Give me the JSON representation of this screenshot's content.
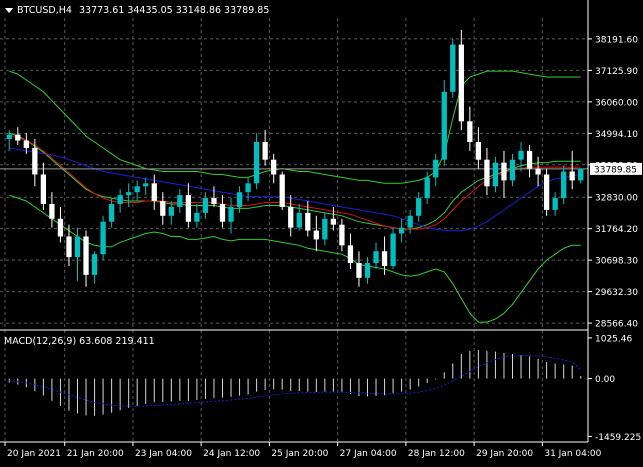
{
  "header": {
    "menu_icon": "triangle-down-icon",
    "symbol": "BTCUSD,H4",
    "ohlc": "33773.61 34435.05 33148.86 33789.85"
  },
  "macd_label": "MACD(12,26,9) 63.608 219.411",
  "colors": {
    "background": "#000000",
    "grid": "#5a5a5a",
    "up_candle": "#00bfbf",
    "down_candle": "#ffffff",
    "bands": "#33cc33",
    "red_ma": "#e01010",
    "blue_ma": "#1c1cd8",
    "text": "#ffffff",
    "price_tag": "#ffffff"
  },
  "chart_data": [
    {
      "type": "candlestick",
      "y_ticks": [
        "38191.60",
        "37125.90",
        "36060.00",
        "34994.10",
        "33928.20",
        "32830.00",
        "31764.20",
        "30698.30",
        "29632.30",
        "28566.40"
      ],
      "ylim": [
        28400,
        38900
      ],
      "last_price": "33789.85",
      "x_ticks": [
        "20 Jan 2021",
        "21 Jan 20:00",
        "23 Jan 04:00",
        "24 Jan 12:00",
        "25 Jan 20:00",
        "27 Jan 04:00",
        "28 Jan 12:00",
        "29 Jan 20:00",
        "31 Jan 04:00"
      ],
      "grid": true,
      "ohlc": [
        [
          34800,
          35100,
          34400,
          34950
        ],
        [
          34950,
          35200,
          34600,
          34750
        ],
        [
          34750,
          35000,
          34300,
          34500
        ],
        [
          34500,
          34800,
          33200,
          33600
        ],
        [
          33600,
          34000,
          32400,
          32600
        ],
        [
          32600,
          33000,
          31800,
          32100
        ],
        [
          32100,
          32500,
          31300,
          31500
        ],
        [
          31500,
          31900,
          30500,
          30800
        ],
        [
          30800,
          31800,
          30000,
          31500
        ],
        [
          31500,
          31700,
          29800,
          30200
        ],
        [
          30200,
          31000,
          29900,
          30900
        ],
        [
          30900,
          32200,
          30700,
          32000
        ],
        [
          32000,
          32800,
          31800,
          32600
        ],
        [
          32600,
          33100,
          32300,
          32900
        ],
        [
          32900,
          33300,
          32500,
          33000
        ],
        [
          33000,
          33400,
          32700,
          33200
        ],
        [
          33200,
          33500,
          32900,
          33300
        ],
        [
          33300,
          33600,
          32400,
          32700
        ],
        [
          32700,
          33000,
          31900,
          32200
        ],
        [
          32200,
          32700,
          31900,
          32500
        ],
        [
          32500,
          33100,
          32300,
          32900
        ],
        [
          32900,
          33300,
          31800,
          32000
        ],
        [
          32000,
          32600,
          31800,
          32300
        ],
        [
          32300,
          33000,
          32100,
          32800
        ],
        [
          32800,
          33200,
          32500,
          32600
        ],
        [
          32600,
          32900,
          31800,
          32000
        ],
        [
          32000,
          32800,
          31600,
          32500
        ],
        [
          32500,
          33200,
          32300,
          33000
        ],
        [
          33000,
          33500,
          32700,
          33300
        ],
        [
          33300,
          35000,
          33100,
          34700
        ],
        [
          34700,
          35100,
          33900,
          34100
        ],
        [
          34100,
          34300,
          33300,
          33600
        ],
        [
          33600,
          33700,
          32400,
          32500
        ],
        [
          32500,
          32900,
          31500,
          31800
        ],
        [
          31800,
          32600,
          31700,
          32300
        ],
        [
          32300,
          32700,
          31500,
          31700
        ],
        [
          31700,
          32200,
          31000,
          31400
        ],
        [
          31400,
          32300,
          31200,
          32100
        ],
        [
          32100,
          32500,
          31700,
          31900
        ],
        [
          31900,
          32100,
          31000,
          31200
        ],
        [
          31200,
          31600,
          30400,
          30600
        ],
        [
          30600,
          31000,
          29800,
          30100
        ],
        [
          30100,
          30800,
          29900,
          30600
        ],
        [
          30600,
          31300,
          30400,
          31000
        ],
        [
          31000,
          31500,
          30200,
          30500
        ],
        [
          30500,
          31800,
          30400,
          31600
        ],
        [
          31600,
          32100,
          31300,
          31800
        ],
        [
          31800,
          32400,
          31600,
          32200
        ],
        [
          32200,
          33000,
          32000,
          32800
        ],
        [
          32800,
          33700,
          32600,
          33500
        ],
        [
          33500,
          34300,
          33200,
          34100
        ],
        [
          34100,
          36800,
          33900,
          36400
        ],
        [
          36400,
          38200,
          36200,
          38000
        ],
        [
          38000,
          38500,
          35100,
          35400
        ],
        [
          35400,
          35900,
          34400,
          34700
        ],
        [
          34700,
          35200,
          33800,
          34100
        ],
        [
          34100,
          34500,
          32900,
          33200
        ],
        [
          33200,
          34200,
          33000,
          34000
        ],
        [
          34000,
          34400,
          32800,
          33400
        ],
        [
          33400,
          34300,
          33200,
          34100
        ],
        [
          34100,
          34700,
          33700,
          34400
        ],
        [
          34400,
          34600,
          33500,
          33800
        ],
        [
          33800,
          34200,
          33200,
          33600
        ],
        [
          33600,
          33800,
          32200,
          32400
        ],
        [
          32400,
          33000,
          32200,
          32800
        ],
        [
          32800,
          33900,
          32600,
          33700
        ],
        [
          33700,
          34400,
          33100,
          33400
        ],
        [
          33400,
          33800,
          33300,
          33790
        ]
      ],
      "bb_upper": [
        37100,
        37000,
        36800,
        36600,
        36400,
        36100,
        35800,
        35500,
        35200,
        34900,
        34700,
        34500,
        34300,
        34100,
        34000,
        33900,
        33800,
        33750,
        33700,
        33700,
        33700,
        33700,
        33700,
        33650,
        33600,
        33600,
        33550,
        33500,
        33500,
        33600,
        33700,
        33750,
        33800,
        33750,
        33700,
        33700,
        33650,
        33600,
        33550,
        33500,
        33450,
        33400,
        33400,
        33350,
        33300,
        33300,
        33300,
        33350,
        33400,
        33500,
        33700,
        34300,
        35500,
        36600,
        36900,
        37000,
        37100,
        37100,
        37100,
        37100,
        37050,
        37000,
        36950,
        36900,
        36900,
        36900,
        36900,
        36900
      ],
      "bb_middle": [
        35000,
        34900,
        34750,
        34550,
        34350,
        34100,
        33850,
        33600,
        33350,
        33100,
        32950,
        32850,
        32800,
        32750,
        32700,
        32700,
        32700,
        32700,
        32650,
        32600,
        32600,
        32550,
        32550,
        32550,
        32550,
        32500,
        32450,
        32450,
        32450,
        32500,
        32550,
        32550,
        32550,
        32500,
        32450,
        32400,
        32350,
        32300,
        32250,
        32200,
        32100,
        32000,
        31950,
        31900,
        31850,
        31800,
        31750,
        31750,
        31800,
        31900,
        32050,
        32300,
        32700,
        33000,
        33200,
        33400,
        33500,
        33600,
        33700,
        33800,
        33900,
        33950,
        34000,
        34000,
        34050,
        34050,
        34050,
        34050
      ],
      "bb_lower": [
        32900,
        32800,
        32700,
        32500,
        32300,
        32100,
        31900,
        31700,
        31500,
        31300,
        31200,
        31150,
        31150,
        31300,
        31400,
        31500,
        31600,
        31650,
        31600,
        31500,
        31500,
        31400,
        31400,
        31450,
        31500,
        31400,
        31350,
        31400,
        31400,
        31400,
        31400,
        31350,
        31300,
        31250,
        31200,
        31100,
        31050,
        31000,
        30950,
        30900,
        30750,
        30550,
        30500,
        30450,
        30400,
        30300,
        30200,
        30150,
        30200,
        30300,
        30400,
        30300,
        29900,
        29400,
        28900,
        28600,
        28600,
        28700,
        28900,
        29200,
        29600,
        30000,
        30400,
        30700,
        30900,
        31100,
        31200,
        31200
      ],
      "ma_red": [
        34900,
        34850,
        34750,
        34600,
        34400,
        34150,
        33900,
        33650,
        33400,
        33150,
        32950,
        32800,
        32700,
        32650,
        32650,
        32650,
        32700,
        32700,
        32700,
        32650,
        32650,
        32650,
        32650,
        32650,
        32650,
        32600,
        32550,
        32550,
        32550,
        32600,
        32650,
        32650,
        32650,
        32600,
        32550,
        32500,
        32450,
        32400,
        32350,
        32300,
        32250,
        32150,
        32050,
        31950,
        31850,
        31800,
        31750,
        31750,
        31750,
        31800,
        31900,
        32100,
        32400,
        32700,
        32950,
        33200,
        33400,
        33550,
        33650,
        33750,
        33800,
        33850,
        33850,
        33850,
        33850,
        33850,
        33850,
        33850
      ],
      "ma_blue": [
        34500,
        34450,
        34400,
        34350,
        34300,
        34250,
        34200,
        34100,
        34000,
        33900,
        33800,
        33700,
        33650,
        33600,
        33550,
        33500,
        33450,
        33400,
        33350,
        33300,
        33250,
        33200,
        33150,
        33100,
        33050,
        33000,
        32950,
        32900,
        32850,
        32850,
        32850,
        32850,
        32850,
        32800,
        32750,
        32700,
        32650,
        32600,
        32550,
        32500,
        32450,
        32400,
        32350,
        32300,
        32250,
        32200,
        32100,
        32000,
        31900,
        31800,
        31750,
        31700,
        31700,
        31700,
        31750,
        31850,
        32000,
        32200,
        32400,
        32600,
        32800,
        33000,
        33200,
        33350,
        33450,
        33500,
        33550,
        33600
      ]
    },
    {
      "type": "bar",
      "title": "MACD(12,26,9) 63.608 219.411",
      "y_ticks": [
        "1025.46",
        "0.00",
        "-1459.225"
      ],
      "ylim": [
        -1600,
        1150
      ],
      "macd": [
        -100,
        -150,
        -220,
        -320,
        -430,
        -560,
        -690,
        -810,
        -880,
        -930,
        -940,
        -910,
        -860,
        -800,
        -740,
        -690,
        -640,
        -600,
        -590,
        -580,
        -560,
        -560,
        -540,
        -510,
        -490,
        -480,
        -460,
        -430,
        -400,
        -330,
        -290,
        -270,
        -280,
        -310,
        -320,
        -330,
        -340,
        -330,
        -330,
        -350,
        -390,
        -440,
        -450,
        -440,
        -420,
        -370,
        -330,
        -280,
        -200,
        -110,
        -20,
        160,
        380,
        620,
        700,
        720,
        700,
        680,
        650,
        620,
        590,
        560,
        500,
        420,
        380,
        360,
        330,
        64
      ],
      "signal": [
        -50,
        -80,
        -110,
        -160,
        -210,
        -270,
        -340,
        -410,
        -480,
        -540,
        -600,
        -640,
        -670,
        -690,
        -700,
        -700,
        -690,
        -680,
        -660,
        -650,
        -640,
        -620,
        -610,
        -590,
        -570,
        -560,
        -540,
        -520,
        -500,
        -470,
        -440,
        -410,
        -390,
        -370,
        -360,
        -350,
        -345,
        -340,
        -340,
        -340,
        -350,
        -360,
        -370,
        -380,
        -390,
        -390,
        -380,
        -370,
        -340,
        -300,
        -250,
        -170,
        -60,
        60,
        180,
        300,
        400,
        480,
        540,
        570,
        580,
        580,
        570,
        550,
        510,
        470,
        420,
        219
      ]
    }
  ]
}
